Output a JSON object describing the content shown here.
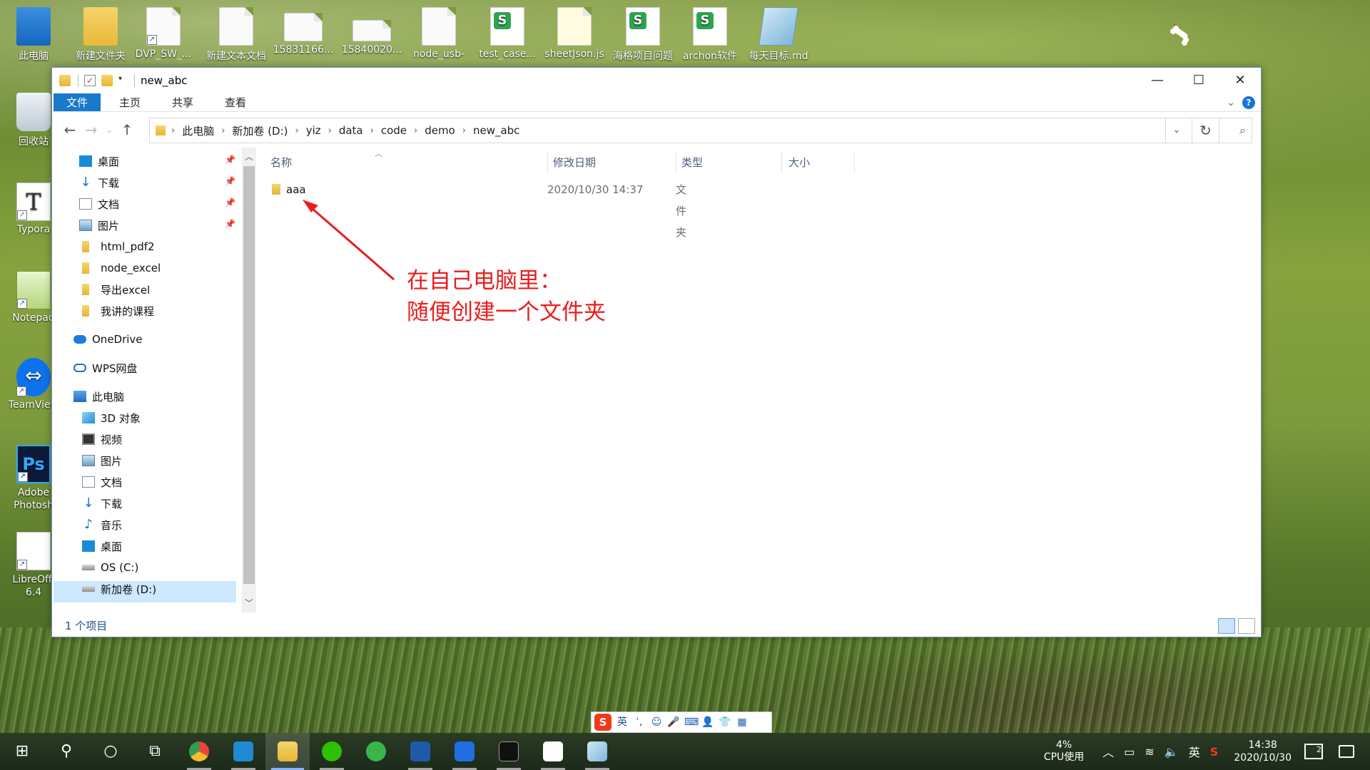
{
  "desktop": {
    "left_icons": [
      {
        "label": "此电脑"
      },
      {
        "label": "回收站"
      },
      {
        "label": "Typora"
      },
      {
        "label": "Notepad"
      },
      {
        "label": "TeamView"
      },
      {
        "label": "Adobe Photosh"
      },
      {
        "label": "LibreOffi 6.4"
      }
    ],
    "top_icons": [
      {
        "label": "新建文件夹"
      },
      {
        "label": "DVP_SW_..."
      },
      {
        "label": "新建文本文档"
      },
      {
        "label": "15831166..."
      },
      {
        "label": "15840020..."
      },
      {
        "label": "node_usb-"
      },
      {
        "label": "test_case..."
      },
      {
        "label": "sheetJson.js"
      },
      {
        "label": "海格项目问题"
      },
      {
        "label": "archon软件"
      },
      {
        "label": "每天目标.md"
      }
    ]
  },
  "window": {
    "title": "new_abc",
    "ribbon_tabs": [
      "文件",
      "主页",
      "共享",
      "查看"
    ],
    "breadcrumb": [
      "此电脑",
      "新加卷 (D:)",
      "yiz",
      "data",
      "code",
      "demo",
      "new_abc"
    ],
    "nav": {
      "quick_access": [
        {
          "label": "桌面",
          "pinned": true
        },
        {
          "label": "下载",
          "pinned": true
        },
        {
          "label": "文档",
          "pinned": true
        },
        {
          "label": "图片",
          "pinned": true
        },
        {
          "label": "html_pdf2"
        },
        {
          "label": "node_excel"
        },
        {
          "label": "导出excel"
        },
        {
          "label": "我讲的课程"
        }
      ],
      "onedrive": "OneDrive",
      "wps": "WPS网盘",
      "this_pc": "此电脑",
      "pc_items": [
        "3D 对象",
        "视频",
        "图片",
        "文档",
        "下载",
        "音乐",
        "桌面",
        "OS (C:)",
        "新加卷 (D:)"
      ]
    },
    "columns": [
      "名称",
      "修改日期",
      "类型",
      "大小"
    ],
    "files": [
      {
        "name": "aaa",
        "modified": "2020/10/30 14:37",
        "type": "文件夹",
        "size": ""
      }
    ],
    "status": "1 个项目"
  },
  "annotation": {
    "line1": "在自己电脑里：",
    "line2": "随便创建一个文件夹",
    "color": "#e81e1e"
  },
  "ime": {
    "mode": "英"
  },
  "taskbar": {
    "cpu_percent": "4%",
    "cpu_label": "CPU使用",
    "ime_indicator": "英",
    "time": "14:38",
    "date": "2020/10/30",
    "notification_count": "2"
  }
}
